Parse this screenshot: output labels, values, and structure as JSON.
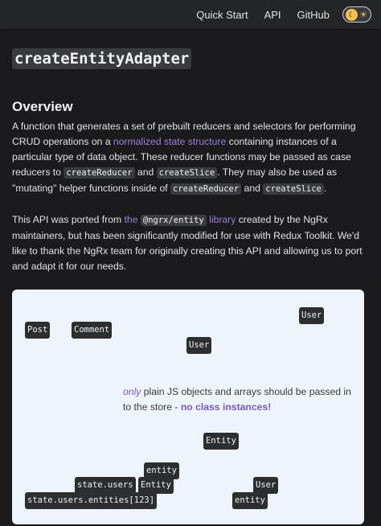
{
  "navbar": {
    "links": [
      "Quick Start",
      "API",
      "GitHub"
    ],
    "toggle_icon": "sun-moon-toggle"
  },
  "page": {
    "title": "createEntityAdapter",
    "overview_heading": "Overview",
    "p1": {
      "a": "A function that generates a set of prebuilt reducers and selectors for performing CRUD operations on a ",
      "link": "normalized state structure",
      "b": " containing instances of a particular type of data object. These reducer functions may be passed as case reducers to ",
      "code1": "createReducer",
      "c": " and ",
      "code2": "createSlice",
      "d": ". They may also be used as \"mutating\" helper functions inside of ",
      "code3": "createReducer",
      "e": " and ",
      "code4": "createSlice",
      "f": "."
    },
    "p2": {
      "a": "This API was ported from ",
      "link_a": "the ",
      "link_code": "@ngrx/entity",
      "link_b": " library",
      "b": " created by the NgRx maintainers, but has been significantly modified for use with Redux Toolkit. We'd like to thank the NgRx team for originally creating this API and allowing us to port and adapt it for our needs."
    }
  },
  "note": {
    "line1_codes": [
      "User",
      "Post",
      "Comment"
    ],
    "line2_code": "User",
    "p2_a": "only",
    "p2_b": " plain JS objects and arrays should be passed in to the store - ",
    "p2_strong": "no class instances!",
    "p3_codes": [
      "Entity",
      "entity",
      "state.users",
      "Entity",
      "User",
      "state.users.entities[123]",
      "entity"
    ]
  },
  "colors": {
    "background": "#1b1b1d",
    "navbar": "#242526",
    "link": "#9b7fd9",
    "note_bg": "#eef4fb",
    "accent": "#7b55cc"
  }
}
